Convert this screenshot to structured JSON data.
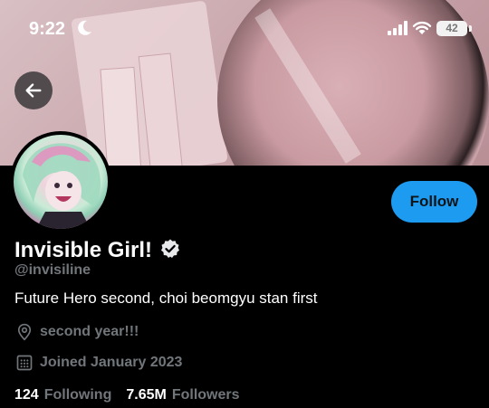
{
  "status_bar": {
    "time": "9:22",
    "battery": "42",
    "icons": [
      "moon-icon",
      "cellular-signal-icon",
      "wifi-icon",
      "battery-icon"
    ]
  },
  "header": {
    "back_icon": "arrow-left-icon"
  },
  "profile": {
    "display_name": "Invisible Girl!",
    "verified_icon": "verified-badge-icon",
    "handle": "@invisiline",
    "bio": "Future Hero second, choi beomgyu stan first",
    "location": "second year!!!",
    "location_icon": "location-pin-icon",
    "joined": "Joined January 2023",
    "joined_icon": "calendar-icon",
    "following_count": "124",
    "following_label": "Following",
    "followers_count": "7.65M",
    "followers_label": "Followers"
  },
  "actions": {
    "follow_label": "Follow"
  },
  "colors": {
    "accent": "#1d9bf0",
    "background": "#000000",
    "text_primary": "#e7e9ea",
    "text_secondary": "#71767b"
  }
}
